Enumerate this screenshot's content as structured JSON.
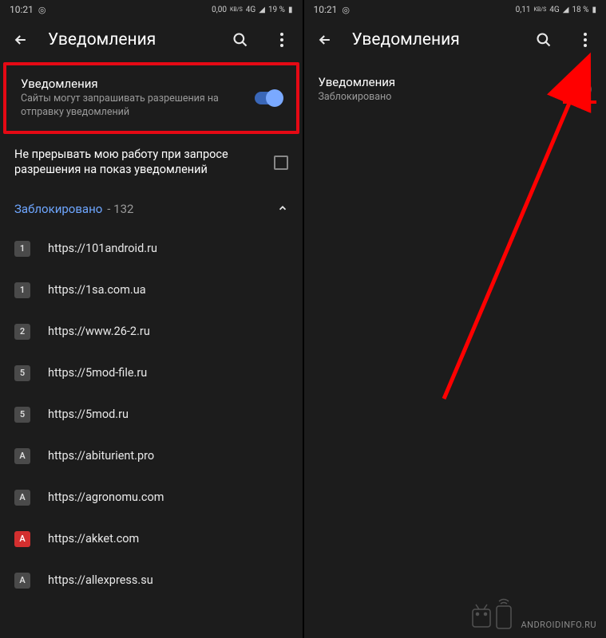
{
  "left": {
    "status": {
      "time": "10:21",
      "speed": "0,00",
      "speed_unit": "KB/S",
      "net": "4G",
      "battery": "19 %"
    },
    "appbar": {
      "title": "Уведомления"
    },
    "main": {
      "title": "Уведомления",
      "desc": "Сайты могут запрашивать разрешения на отправку уведомлений"
    },
    "quiet": {
      "text": "Не прерывать мою работу при запросе разрешения на показ уведомлений"
    },
    "section": {
      "label": "Заблокировано",
      "count": " - 132"
    },
    "sites": [
      {
        "badge": "1",
        "url": "https://101android.ru"
      },
      {
        "badge": "1",
        "url": "https://1sa.com.ua"
      },
      {
        "badge": "2",
        "url": "https://www.26-2.ru"
      },
      {
        "badge": "5",
        "url": "https://5mod-file.ru"
      },
      {
        "badge": "5",
        "url": "https://5mod.ru"
      },
      {
        "badge": "A",
        "url": "https://abiturient.pro"
      },
      {
        "badge": "A",
        "url": "https://agronomu.com"
      },
      {
        "badge": "A",
        "url": "https://akket.com",
        "red": true
      },
      {
        "badge": "A",
        "url": "https://allexpress.su"
      }
    ]
  },
  "right": {
    "status": {
      "time": "10:21",
      "speed": "0,11",
      "speed_unit": "KB/S",
      "net": "4G",
      "battery": "18 %"
    },
    "appbar": {
      "title": "Уведомления"
    },
    "main": {
      "title": "Уведомления",
      "desc": "Заблокировано"
    }
  },
  "watermark": "ANDROIDINFO.RU"
}
